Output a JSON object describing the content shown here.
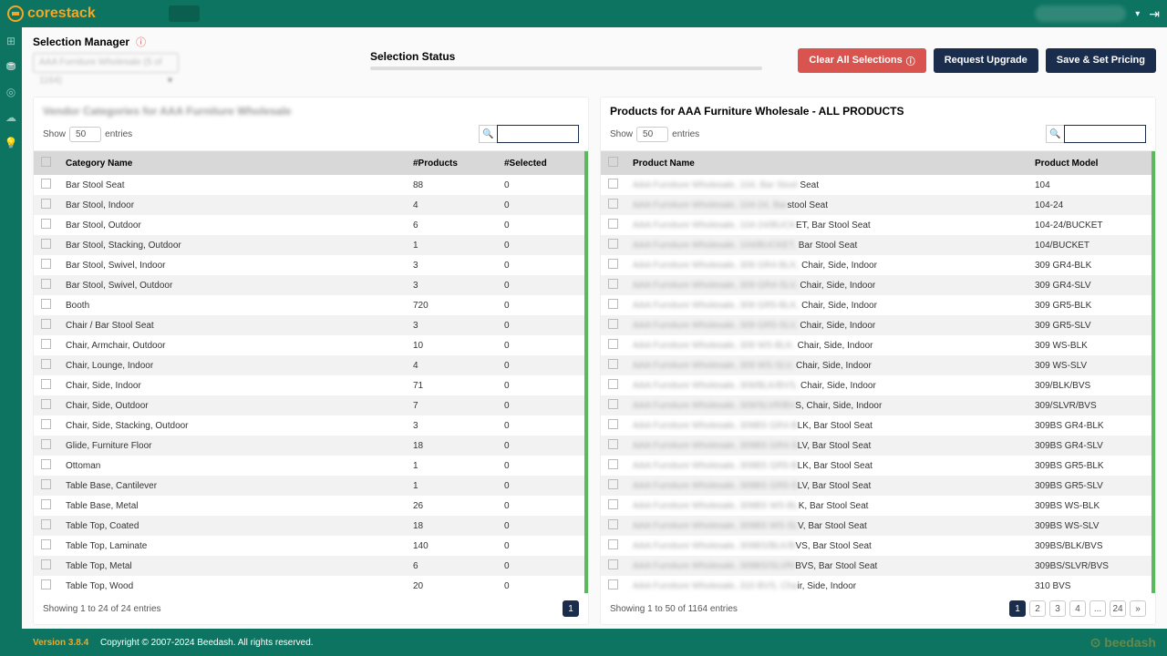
{
  "brand": "corestack",
  "topbar": {
    "dropdown_placeholder": "                    "
  },
  "header": {
    "selection_manager": "Selection Manager",
    "vendor_placeholder": "AAA Furniture Wholesale (5 of 1164)",
    "status_label": "Selection Status"
  },
  "actions": {
    "clear": "Clear All Selections",
    "upgrade": "Request Upgrade",
    "save": "Save & Set Pricing"
  },
  "left_panel": {
    "title": "Vendor Categories for AAA Furniture Wholesale",
    "show": "Show",
    "entries": "entries",
    "page_size": "50",
    "col_category": "Category Name",
    "col_products": "#Products",
    "col_selected": "#Selected",
    "rows": [
      {
        "name": "Bar Stool Seat",
        "p": "88",
        "s": "0"
      },
      {
        "name": "Bar Stool, Indoor",
        "p": "4",
        "s": "0"
      },
      {
        "name": "Bar Stool, Outdoor",
        "p": "6",
        "s": "0"
      },
      {
        "name": "Bar Stool, Stacking, Outdoor",
        "p": "1",
        "s": "0"
      },
      {
        "name": "Bar Stool, Swivel, Indoor",
        "p": "3",
        "s": "0"
      },
      {
        "name": "Bar Stool, Swivel, Outdoor",
        "p": "3",
        "s": "0"
      },
      {
        "name": "Booth",
        "p": "720",
        "s": "0"
      },
      {
        "name": "Chair / Bar Stool Seat",
        "p": "3",
        "s": "0"
      },
      {
        "name": "Chair, Armchair, Outdoor",
        "p": "10",
        "s": "0"
      },
      {
        "name": "Chair, Lounge, Indoor",
        "p": "4",
        "s": "0"
      },
      {
        "name": "Chair, Side, Indoor",
        "p": "71",
        "s": "0"
      },
      {
        "name": "Chair, Side, Outdoor",
        "p": "7",
        "s": "0"
      },
      {
        "name": "Chair, Side, Stacking, Outdoor",
        "p": "3",
        "s": "0"
      },
      {
        "name": "Glide, Furniture Floor",
        "p": "18",
        "s": "0"
      },
      {
        "name": "Ottoman",
        "p": "1",
        "s": "0"
      },
      {
        "name": "Table Base, Cantilever",
        "p": "1",
        "s": "0"
      },
      {
        "name": "Table Base, Metal",
        "p": "26",
        "s": "0"
      },
      {
        "name": "Table Top, Coated",
        "p": "18",
        "s": "0"
      },
      {
        "name": "Table Top, Laminate",
        "p": "140",
        "s": "0"
      },
      {
        "name": "Table Top, Metal",
        "p": "6",
        "s": "0"
      },
      {
        "name": "Table Top, Wood",
        "p": "20",
        "s": "0"
      }
    ],
    "showing": "Showing 1 to 24 of 24 entries",
    "page1": "1"
  },
  "right_panel": {
    "title": "Products for AAA Furniture Wholesale - ALL PRODUCTS",
    "show": "Show",
    "entries": "entries",
    "page_size": "50",
    "col_product": "Product Name",
    "col_model": "Product Model",
    "rows": [
      {
        "pre": "AAA Furniture Wholesale, 104, Bar Stool",
        "tail": " Seat",
        "model": "104"
      },
      {
        "pre": "AAA Furniture Wholesale, 104-24, Bar",
        "tail": "stool Seat",
        "model": "104-24"
      },
      {
        "pre": "AAA Furniture Wholesale, 104-24/BUCK",
        "tail": "ET, Bar Stool Seat",
        "model": "104-24/BUCKET"
      },
      {
        "pre": "AAA Furniture Wholesale, 104/BUCKET,",
        "tail": " Bar Stool Seat",
        "model": "104/BUCKET"
      },
      {
        "pre": "AAA Furniture Wholesale, 309 GR4-BLK,",
        "tail": " Chair, Side, Indoor",
        "model": "309 GR4-BLK"
      },
      {
        "pre": "AAA Furniture Wholesale, 309 GR4-SLV,",
        "tail": " Chair, Side, Indoor",
        "model": "309 GR4-SLV"
      },
      {
        "pre": "AAA Furniture Wholesale, 309 GR5-BLK,",
        "tail": " Chair, Side, Indoor",
        "model": "309 GR5-BLK"
      },
      {
        "pre": "AAA Furniture Wholesale, 309 GR5-SLV,",
        "tail": " Chair, Side, Indoor",
        "model": "309 GR5-SLV"
      },
      {
        "pre": "AAA Furniture Wholesale, 309 WS-BLK,",
        "tail": " Chair, Side, Indoor",
        "model": "309 WS-BLK"
      },
      {
        "pre": "AAA Furniture Wholesale, 309 WS-SLV,",
        "tail": " Chair, Side, Indoor",
        "model": "309 WS-SLV"
      },
      {
        "pre": "AAA Furniture Wholesale, 309/BLK/BVS,",
        "tail": " Chair, Side, Indoor",
        "model": "309/BLK/BVS"
      },
      {
        "pre": "AAA Furniture Wholesale, 309/SLVR/BV",
        "tail": "S, Chair, Side, Indoor",
        "model": "309/SLVR/BVS"
      },
      {
        "pre": "AAA Furniture Wholesale, 309BS GR4-B",
        "tail": "LK, Bar Stool Seat",
        "model": "309BS GR4-BLK"
      },
      {
        "pre": "AAA Furniture Wholesale, 309BS GR4-S",
        "tail": "LV, Bar Stool Seat",
        "model": "309BS GR4-SLV"
      },
      {
        "pre": "AAA Furniture Wholesale, 309BS GR5-B",
        "tail": "LK, Bar Stool Seat",
        "model": "309BS GR5-BLK"
      },
      {
        "pre": "AAA Furniture Wholesale, 309BS GR5-S",
        "tail": "LV, Bar Stool Seat",
        "model": "309BS GR5-SLV"
      },
      {
        "pre": "AAA Furniture Wholesale, 309BS WS-BL",
        "tail": "K, Bar Stool Seat",
        "model": "309BS WS-BLK"
      },
      {
        "pre": "AAA Furniture Wholesale, 309BS WS-SL",
        "tail": "V, Bar Stool Seat",
        "model": "309BS WS-SLV"
      },
      {
        "pre": "AAA Furniture Wholesale, 309BS/BLK/B",
        "tail": "VS, Bar Stool Seat",
        "model": "309BS/BLK/BVS"
      },
      {
        "pre": "AAA Furniture Wholesale, 309BS/SLVR/",
        "tail": "BVS, Bar Stool Seat",
        "model": "309BS/SLVR/BVS"
      },
      {
        "pre": "AAA Furniture Wholesale, 310 BVS, Cha",
        "tail": "ir, Side, Indoor",
        "model": "310 BVS"
      }
    ],
    "showing": "Showing 1 to 50 of 1164 entries",
    "pages": [
      "1",
      "2",
      "3",
      "4",
      "...",
      "24",
      "»"
    ]
  },
  "footer": {
    "version": "Version 3.8.4",
    "copyright": "Copyright © 2007-2024 Beedash. All rights reserved.",
    "brand": "beedash"
  }
}
